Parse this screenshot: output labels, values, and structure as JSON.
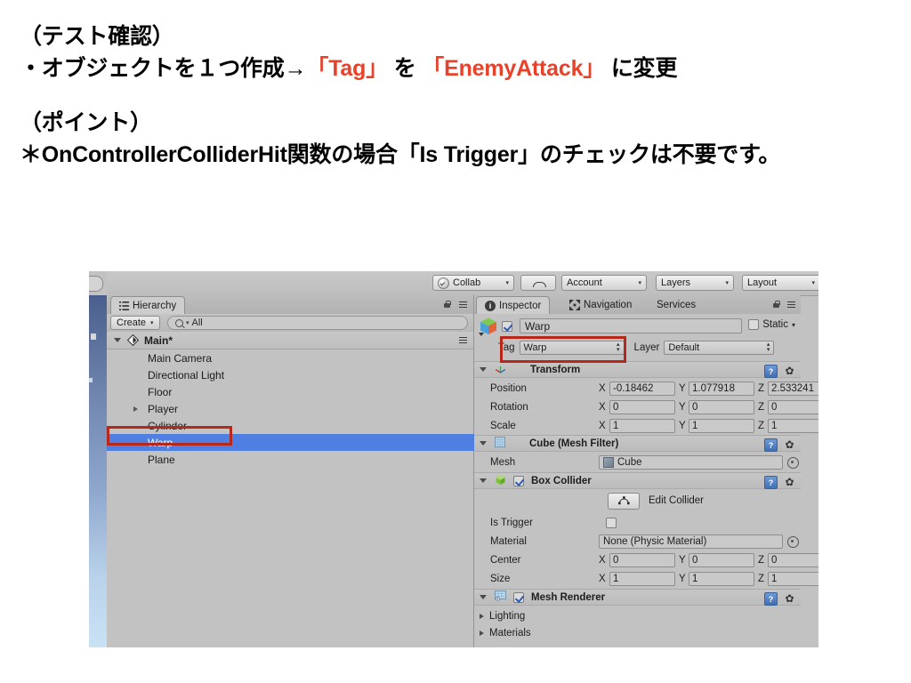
{
  "slide": {
    "block1_heading": "（テスト確認）",
    "block1_line_a": "・オブジェクトを１つ作成→",
    "block1_accent1": "「Tag」",
    "block1_mid": " を ",
    "block1_accent2": "「EnemyAttack」",
    "block1_tail": " に変更",
    "block2_heading": "（ポイント）",
    "block2_body": "＊OnControllerColliderHit関数の場合「Is Trigger」のチェックは不要です。",
    "accent_color": "#e8422a"
  },
  "unity": {
    "toolbar": {
      "collab": "Collab",
      "cloud_icon": "cloud-icon",
      "account": "Account",
      "layers": "Layers",
      "layout": "Layout"
    },
    "hierarchy": {
      "tab_label": "Hierarchy",
      "tab_icon": "hierarchy-list-icon",
      "lock_icon": "lock-icon",
      "menu_icon": "panel-menu-icon",
      "create_label": "Create",
      "search_placeholder": "All",
      "search_value": "All",
      "search_icon": "search-icon",
      "scene_name": "Main*",
      "items": [
        {
          "label": "Main Camera",
          "expandable": false,
          "selected": false
        },
        {
          "label": "Directional Light",
          "expandable": false,
          "selected": false
        },
        {
          "label": "Floor",
          "expandable": false,
          "selected": false
        },
        {
          "label": "Player",
          "expandable": true,
          "selected": false
        },
        {
          "label": "Cylinder",
          "expandable": false,
          "selected": false
        },
        {
          "label": "Warp",
          "expandable": false,
          "selected": true
        },
        {
          "label": "Plane",
          "expandable": false,
          "selected": false
        }
      ]
    },
    "inspector": {
      "tabs": [
        {
          "label": "Inspector",
          "icon": "info-icon",
          "active": true
        },
        {
          "label": "Navigation",
          "icon": "navigation-icon",
          "active": false
        },
        {
          "label": "Services",
          "icon": "",
          "active": false
        }
      ],
      "lock_icon": "lock-icon",
      "menu_icon": "panel-menu-icon",
      "object_name": "Warp",
      "object_enabled": true,
      "static_label": "Static",
      "static_checked": false,
      "tag_label": "Tag",
      "tag_value": "Warp",
      "layer_label": "Layer",
      "layer_value": "Default",
      "components": {
        "transform": {
          "title": "Transform",
          "icon": "transform-axes-icon",
          "rows": [
            {
              "label": "Position",
              "x": "-0.18462",
              "y": "1.077918",
              "z": "2.533241"
            },
            {
              "label": "Rotation",
              "x": "0",
              "y": "0",
              "z": "0"
            },
            {
              "label": "Scale",
              "x": "1",
              "y": "1",
              "z": "1"
            }
          ],
          "axis_x": "X",
          "axis_y": "Y",
          "axis_z": "Z"
        },
        "mesh_filter": {
          "title": "Cube (Mesh Filter)",
          "icon": "mesh-filter-icon",
          "mesh_label": "Mesh",
          "mesh_value": "Cube"
        },
        "box_collider": {
          "title": "Box Collider",
          "icon": "box-collider-icon",
          "enabled": true,
          "edit_collider_label": "Edit Collider",
          "edit_collider_icon": "edit-collider-icon",
          "is_trigger_label": "Is Trigger",
          "is_trigger_checked": false,
          "material_label": "Material",
          "material_value": "None (Physic Material)",
          "center_label": "Center",
          "center": {
            "x": "0",
            "y": "0",
            "z": "0"
          },
          "size_label": "Size",
          "size": {
            "x": "1",
            "y": "1",
            "z": "1"
          }
        },
        "mesh_renderer": {
          "title": "Mesh Renderer",
          "icon": "mesh-renderer-icon",
          "enabled": true,
          "lighting_label": "Lighting",
          "materials_label": "Materials"
        }
      },
      "help_icon": "help-icon",
      "gear_icon": "gear-icon"
    },
    "annotations": {
      "highlight_color": "#b5281b",
      "boxes": [
        "hierarchy-warp-row",
        "inspector-tag-field"
      ]
    }
  }
}
